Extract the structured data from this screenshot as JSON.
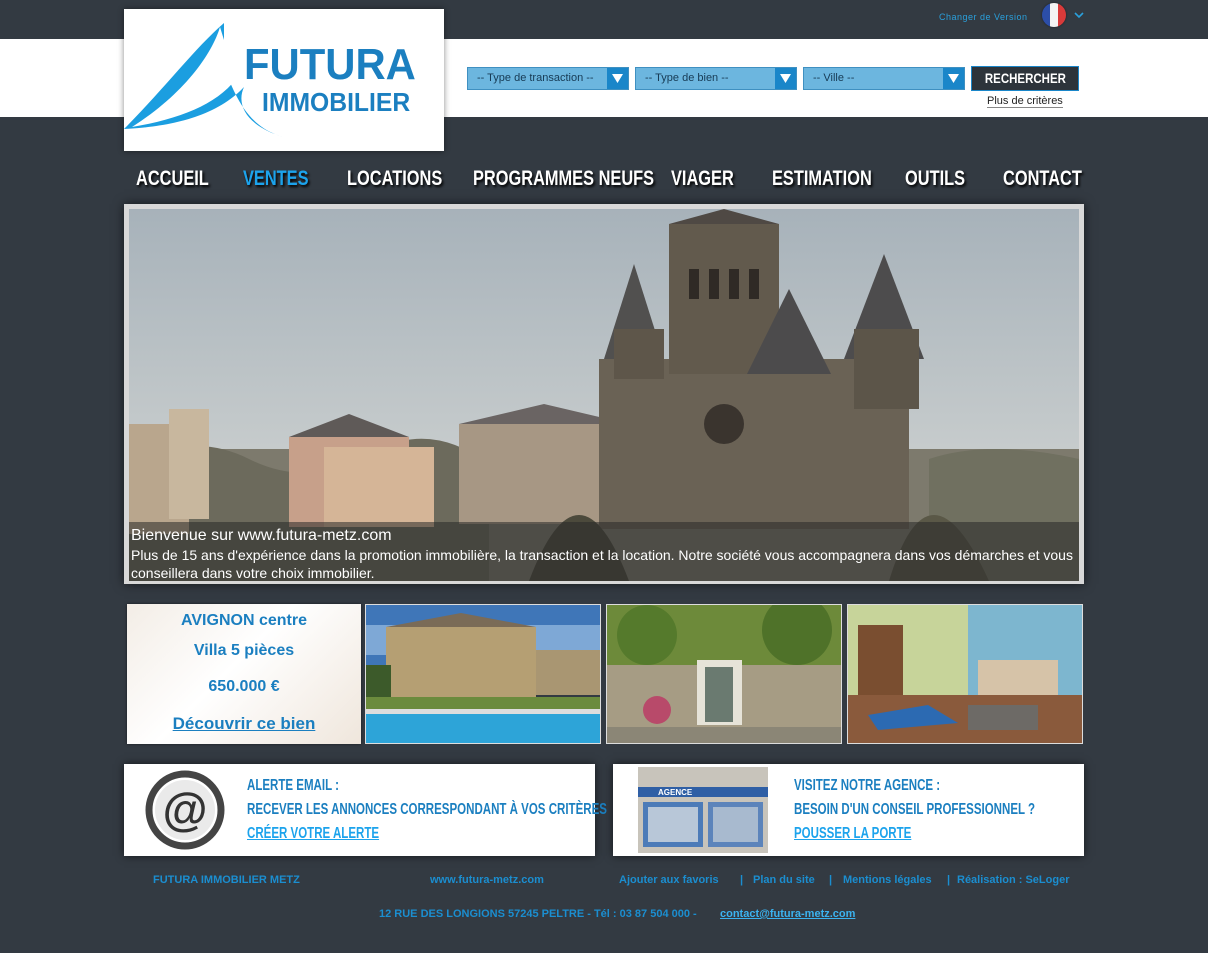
{
  "header": {
    "logo_line1": "FUTURA",
    "logo_line2": "IMMOBILIER",
    "version_label": "Changer de Version"
  },
  "search": {
    "transaction_select": "-- Type de transaction --",
    "property_select": "-- Type de bien --",
    "city_select": "-- Ville --",
    "search_button": "RECHERCHER",
    "more_criteria": "Plus de critères"
  },
  "nav": {
    "items": [
      {
        "label": "ACCUEIL"
      },
      {
        "label": "VENTES"
      },
      {
        "label": "LOCATIONS"
      },
      {
        "label": "PROGRAMMES NEUFS"
      },
      {
        "label": "VIAGER"
      },
      {
        "label": "ESTIMATION"
      },
      {
        "label": "OUTILS"
      },
      {
        "label": "CONTACT"
      }
    ],
    "active": "VENTES"
  },
  "hero": {
    "title": "Bienvenue sur www.futura-metz.com",
    "body": "Plus de 15 ans d'expérience dans la promotion immobilière, la transaction et la location. Notre société vous accompagnera dans vos démarches et vous conseillera dans votre choix immobilier."
  },
  "promo": {
    "location": "AVIGNON centre",
    "type": "Villa 5 pièces",
    "price": "650.000 €",
    "link": "Découvrir ce bien"
  },
  "alert_card": {
    "line1": "ALERTE EMAIL :",
    "line2": "RECEVER LES ANNONCES CORRESPONDANT À VOS CRITÈRES",
    "link": "CRÉER VOTRE ALERTE"
  },
  "agency_card": {
    "line1": "VISITEZ NOTRE AGENCE :",
    "line2": "BESOIN D'UN CONSEIL PROFESSIONNEL ?",
    "link": "POUSSER LA PORTE",
    "storefront_sign": "AGENCE"
  },
  "footer": {
    "company": "FUTURA IMMOBILIER METZ",
    "website": "www.futura-metz.com",
    "favorites": "Ajouter aux favoris",
    "sitemap": "Plan du site",
    "legal": "Mentions légales",
    "credit": "Réalisation : SeLoger",
    "separator": "|",
    "address": "12 RUE DES LONGIONS 57245 PELTRE  -  Tél : 03 87 504 000  -",
    "email": "contact@futura-metz.com"
  },
  "colors": {
    "background": "#333a42",
    "brand_blue": "#1b7fc0",
    "accent_blue": "#1ca3ec",
    "select_blue": "#6cb6df"
  }
}
